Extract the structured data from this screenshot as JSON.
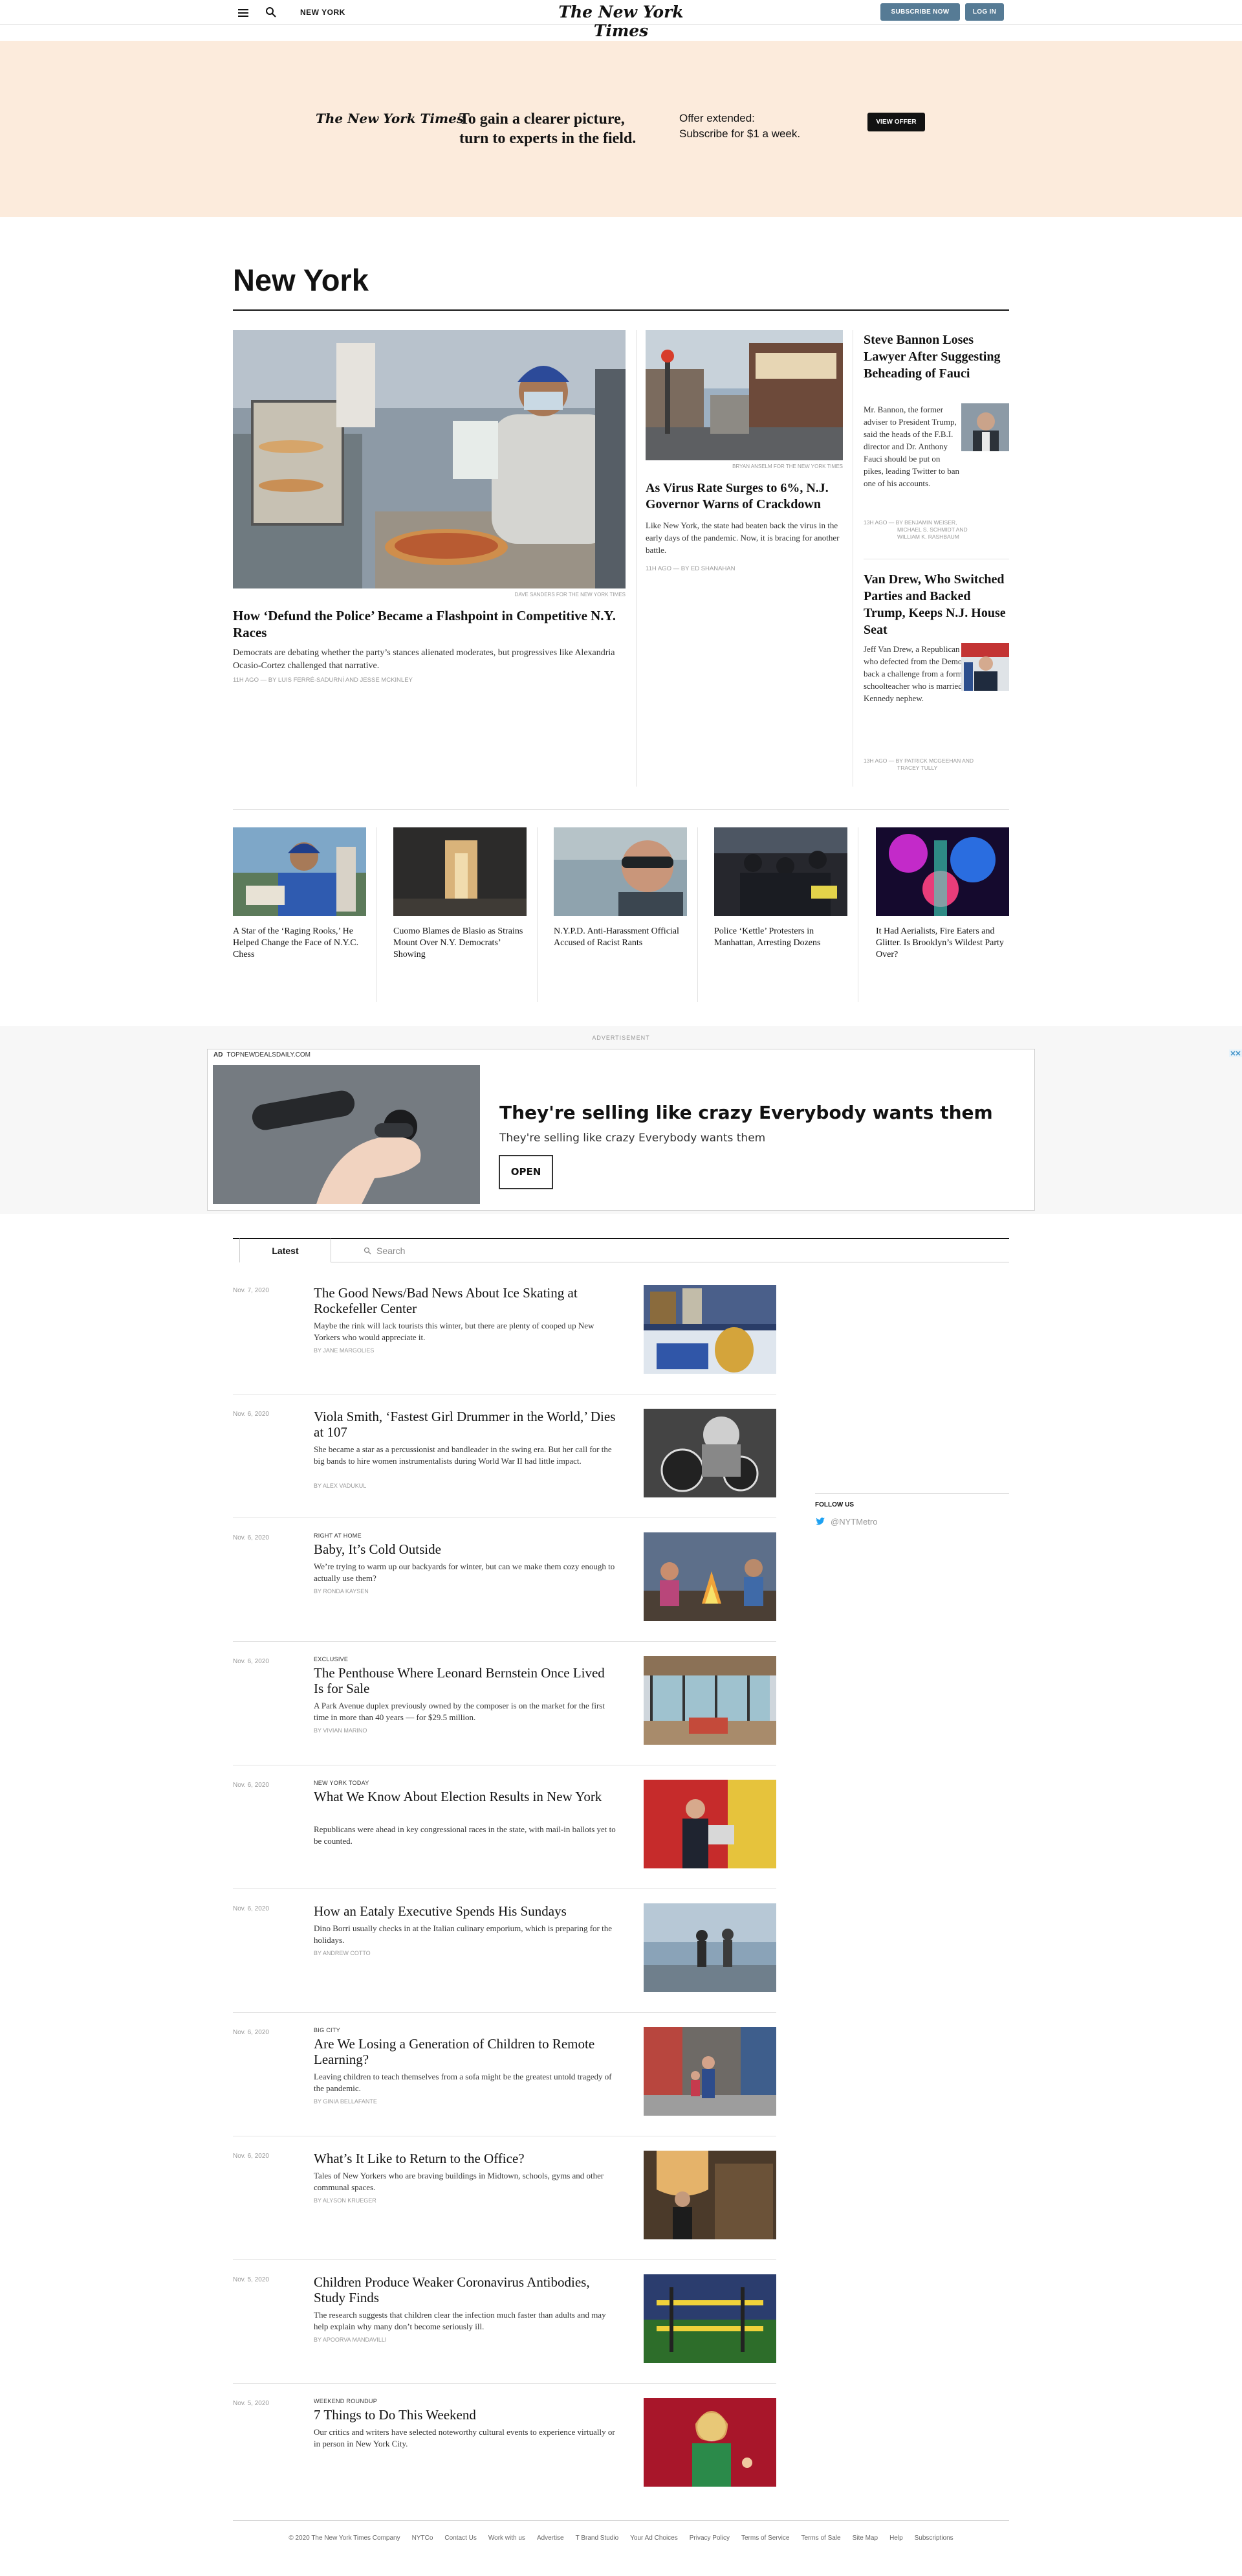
{
  "topbar": {
    "section": "NEW YORK",
    "logo": "The New York Times",
    "subscribe": "SUBSCRIBE NOW",
    "login": "LOG IN"
  },
  "promo": {
    "logo": "The New York Times",
    "headline": "To gain a clearer picture, turn to experts in the field.",
    "offer_line1": "Offer extended:",
    "offer_line2": "Subscribe for $1 a week.",
    "cta": "VIEW OFFER"
  },
  "page_title": "New York",
  "lead": {
    "credit": "DAVE SANDERS FOR THE NEW YORK TIMES",
    "headline": "How ‘Defund the Police’ Became a Flashpoint in Competitive N.Y. Races",
    "summary": "Democrats are debating whether the party’s stances alienated moderates, but progressives like Alexandria Ocasio-Cortez challenged that narrative.",
    "byline": "11h ago — By LUIS FERRÉ-SADURNÍ and JESSE McKINLEY"
  },
  "second": {
    "credit": "BRYAN ANSELM FOR THE NEW YORK TIMES",
    "headline": "As Virus Rate Surges to 6%, N.J. Governor Warns of Crackdown",
    "summary": "Like New York, the state had beaten back the virus in the early days of the pandemic. Now, it is bracing for another battle.",
    "byline": "11h ago — By ED SHANAHAN"
  },
  "right1": {
    "headline": "Steve Bannon Loses Lawyer After Suggesting Beheading of Fauci",
    "summary": "Mr. Bannon, the former adviser to President Trump, said the heads of the F.B.I. director and Dr. Anthony Fauci should be put on pikes, leading Twitter to ban one of his accounts.",
    "byline_line1": "13h ago — By BENJAMIN WEISER,",
    "byline_line2": "MICHAEL S. SCHMIDT and",
    "byline_line3": "WILLIAM K. RASHBAUM"
  },
  "right2": {
    "headline": "Van Drew, Who Switched Parties and Backed Trump, Keeps N.J. House Seat",
    "summary": "Jeff Van Drew, a Republican congressman who defected from the Democrats, beat back a challenge from a former schoolteacher who is married to a Kennedy nephew.",
    "byline_line1": "13h ago — By PATRICK McGEEHAN and",
    "byline_line2": "TRACEY TULLY"
  },
  "strip": [
    {
      "headline": "A Star of the ‘Raging Rooks,’ He Helped Change the Face of N.Y.C. Chess"
    },
    {
      "headline": "Cuomo Blames de Blasio as Strains Mount Over N.Y. Democrats’ Showing"
    },
    {
      "headline": "N.Y.P.D. Anti-Harassment Official Accused of Racist Rants"
    },
    {
      "headline": "Police ‘Kettle’ Protesters in Manhattan, Arresting Dozens"
    },
    {
      "headline": "It Had Aerialists, Fire Eaters and Glitter. Is Brooklyn’s Wildest Party Over?"
    }
  ],
  "ad": {
    "label": "ADVERTISEMENT",
    "badge": "AD",
    "source": "TOPNEWDEALSDAILY.COM",
    "headline": "They're selling like crazy Everybody wants them",
    "sub": "They're selling like crazy Everybody wants them",
    "cta": "OPEN"
  },
  "latest": {
    "tab": "Latest",
    "search_placeholder": "Search",
    "items": [
      {
        "date": "Nov. 7, 2020",
        "kicker": "",
        "headline": "The Good News/Bad News About Ice Skating at Rockefeller Center",
        "summary": "Maybe the rink will lack tourists this winter, but there are plenty of cooped up New Yorkers who would appreciate it.",
        "byline": "By JANE MARGOLIES"
      },
      {
        "date": "Nov. 6, 2020",
        "kicker": "",
        "headline": "Viola Smith, ‘Fastest Girl Drummer in the World,’ Dies at 107",
        "summary": "She became a star as a percussionist and bandleader in the swing era. But her call for the big bands to hire women instrumentalists during World War II had little impact.",
        "byline": "By ALEX VADUKUL"
      },
      {
        "date": "Nov. 6, 2020",
        "kicker": "RIGHT AT HOME",
        "headline": "Baby, It’s Cold Outside",
        "summary": "We’re trying to warm up our backyards for winter, but can we make them cozy enough to actually use them?",
        "byline": "By RONDA KAYSEN"
      },
      {
        "date": "Nov. 6, 2020",
        "kicker": "EXCLUSIVE",
        "headline": "The Penthouse Where Leonard Bernstein Once Lived Is for Sale",
        "summary": "A Park Avenue duplex previously owned by the composer is on the market for the first time in more than 40 years — for $29.5 million.",
        "byline": "By VIVIAN MARINO"
      },
      {
        "date": "Nov. 6, 2020",
        "kicker": "NEW YORK TODAY",
        "headline": "What We Know About Election Results in New York",
        "summary": "Republicans were ahead in key congressional races in the state, with mail-in ballots yet to be counted.",
        "byline": ""
      },
      {
        "date": "Nov. 6, 2020",
        "kicker": "",
        "headline": "How an Eataly Executive Spends His Sundays",
        "summary": "Dino Borri usually checks in at the Italian culinary emporium, which is preparing for the holidays.",
        "byline": "By ANDREW COTTO"
      },
      {
        "date": "Nov. 6, 2020",
        "kicker": "BIG CITY",
        "headline": "Are We Losing a Generation of Children to Remote Learning?",
        "summary": "Leaving children to teach themselves from a sofa might be the greatest untold tragedy of the pandemic.",
        "byline": "By GINIA BELLAFANTE"
      },
      {
        "date": "Nov. 6, 2020",
        "kicker": "",
        "headline": "What’s It Like to Return to the Office?",
        "summary": "Tales of New Yorkers who are braving buildings in Midtown, schools, gyms and other communal spaces.",
        "byline": "By ALYSON KRUEGER"
      },
      {
        "date": "Nov. 5, 2020",
        "kicker": "",
        "headline": "Children Produce Weaker Coronavirus Antibodies, Study Finds",
        "summary": "The research suggests that children clear the infection much faster than adults and may help explain why many don’t become seriously ill.",
        "byline": "By APOORVA MANDAVILLI"
      },
      {
        "date": "Nov. 5, 2020",
        "kicker": "WEEKEND ROUNDUP",
        "headline": "7 Things to Do This Weekend",
        "summary": "Our critics and writers have selected noteworthy cultural events to experience virtually or in person in New York City.",
        "byline": ""
      }
    ]
  },
  "follow": {
    "label": "FOLLOW US",
    "handle": "@NYTMetro"
  },
  "footer": {
    "links": [
      "© 2020 The New York Times Company",
      "NYTCo",
      "Contact Us",
      "Work with us",
      "Advertise",
      "T Brand Studio",
      "Your Ad Choices",
      "Privacy Policy",
      "Terms of Service",
      "Terms of Sale",
      "Site Map",
      "Help",
      "Subscriptions"
    ]
  },
  "colors": {
    "promo_bg": "#fcebdc",
    "button_blue": "#567b95",
    "twitter_blue": "#1da1f2"
  }
}
